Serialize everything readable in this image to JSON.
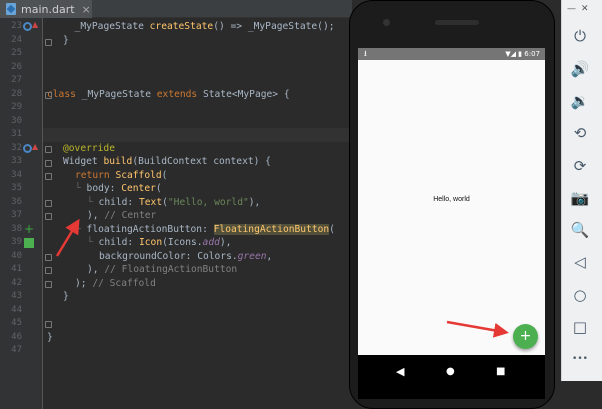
{
  "editor": {
    "tab_label": "main.dart",
    "tab_close": "×",
    "lines": [
      {
        "n": "23",
        "code": "  _MyPageState createState() => _MyPageState();"
      },
      {
        "n": "24",
        "code": "}"
      },
      {
        "n": "25",
        "code": ""
      },
      {
        "n": "26",
        "code": ""
      },
      {
        "n": "27",
        "code": "class _MyPageState extends State<MyPage> {"
      },
      {
        "n": "28",
        "code": ""
      },
      {
        "n": "29",
        "code": ""
      },
      {
        "n": "30",
        "code": ""
      },
      {
        "n": "31",
        "code": ""
      },
      {
        "n": "32",
        "code": "  @override"
      },
      {
        "n": "33",
        "code": "  Widget build(BuildContext context) {"
      },
      {
        "n": "34",
        "code": "    return Scaffold("
      },
      {
        "n": "35",
        "code": "      body: Center("
      },
      {
        "n": "36",
        "code": "        child: Text(\"Hello, world\"),"
      },
      {
        "n": "37",
        "code": "      ), // Center"
      },
      {
        "n": "38",
        "code": "      floatingActionButton: FloatingActionButton("
      },
      {
        "n": "39",
        "code": "        child: Icon(Icons.add),"
      },
      {
        "n": "40",
        "code": "        backgroundColor: Colors.green,"
      },
      {
        "n": "41",
        "code": "      ), // FloatingActionButton"
      },
      {
        "n": "42",
        "code": "    ); // Scaffold"
      },
      {
        "n": "43",
        "code": "  }"
      },
      {
        "n": "44",
        "code": ""
      },
      {
        "n": "45",
        "code": ""
      },
      {
        "n": "46",
        "code": "}"
      },
      {
        "n": "47",
        "code": ""
      }
    ],
    "raw_numbers": [
      "23",
      "24",
      "25",
      "26",
      "27",
      "28",
      "29",
      "30",
      "31",
      "32",
      "33",
      "34",
      "35",
      "36",
      "37",
      "38",
      "39",
      "40",
      "41",
      "42",
      "43",
      "44",
      "45",
      "46",
      "47"
    ]
  },
  "emulator": {
    "status_time": "6:07",
    "status_left_icon": "download-icon",
    "body_text": "Hello, world",
    "fab_label": "+",
    "nav": {
      "back": "◀",
      "home": "●",
      "recents": "■"
    }
  },
  "side_panel": {
    "minimize": "—",
    "close": "✕",
    "buttons": [
      "power-icon",
      "volume-up-icon",
      "volume-down-icon",
      "rotate-left-icon",
      "rotate-right-icon",
      "camera-icon",
      "zoom-icon",
      "back-icon",
      "home-icon",
      "overview-icon",
      "more-icon"
    ],
    "glyphs": [
      "⏻",
      "🔊",
      "🔉",
      "⟲",
      "⟳",
      "📷",
      "🔍",
      "◁",
      "○",
      "□",
      "•••"
    ]
  },
  "colors": {
    "fab": "#4caf50",
    "arrow": "#e53935",
    "keyword": "#cc7832",
    "string": "#6a8759"
  }
}
